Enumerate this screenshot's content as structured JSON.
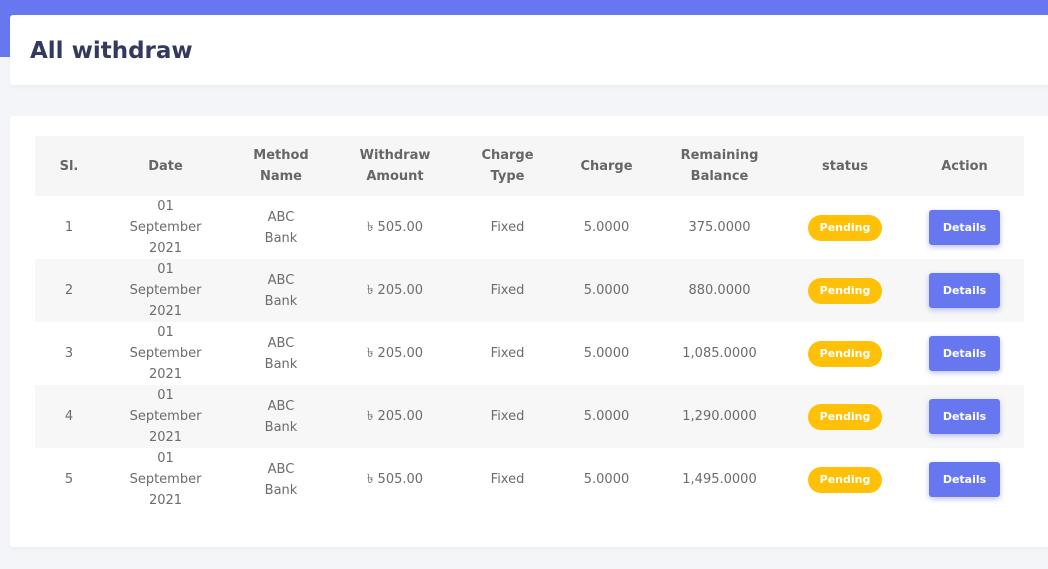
{
  "page": {
    "title": "All withdraw"
  },
  "colors": {
    "header_bar": "#6777ef",
    "badge_pending": "#ffc107",
    "button": "#6777ef"
  },
  "table": {
    "headers": {
      "sl": "Sl.",
      "date": "Date",
      "method_1": "Method",
      "method_2": "Name",
      "amount_1": "Withdraw",
      "amount_2": "Amount",
      "ctype_1": "Charge",
      "ctype_2": "Type",
      "charge": "Charge",
      "remain_1": "Remaining",
      "remain_2": "Balance",
      "status": "status",
      "action": "Action"
    },
    "rows": [
      {
        "sl": "1",
        "date_1": "01",
        "date_2": "September",
        "date_3": "2021",
        "method_1": "ABC",
        "method_2": "Bank",
        "amount": "৳ 505.00",
        "charge_type": "Fixed",
        "charge": "5.0000",
        "remaining": "375.0000",
        "status": "Pending",
        "action": "Details"
      },
      {
        "sl": "2",
        "date_1": "01",
        "date_2": "September",
        "date_3": "2021",
        "method_1": "ABC",
        "method_2": "Bank",
        "amount": "৳ 205.00",
        "charge_type": "Fixed",
        "charge": "5.0000",
        "remaining": "880.0000",
        "status": "Pending",
        "action": "Details"
      },
      {
        "sl": "3",
        "date_1": "01",
        "date_2": "September",
        "date_3": "2021",
        "method_1": "ABC",
        "method_2": "Bank",
        "amount": "৳ 205.00",
        "charge_type": "Fixed",
        "charge": "5.0000",
        "remaining": "1,085.0000",
        "status": "Pending",
        "action": "Details"
      },
      {
        "sl": "4",
        "date_1": "01",
        "date_2": "September",
        "date_3": "2021",
        "method_1": "ABC",
        "method_2": "Bank",
        "amount": "৳ 205.00",
        "charge_type": "Fixed",
        "charge": "5.0000",
        "remaining": "1,290.0000",
        "status": "Pending",
        "action": "Details"
      },
      {
        "sl": "5",
        "date_1": "01",
        "date_2": "September",
        "date_3": "2021",
        "method_1": "ABC",
        "method_2": "Bank",
        "amount": "৳ 505.00",
        "charge_type": "Fixed",
        "charge": "5.0000",
        "remaining": "1,495.0000",
        "status": "Pending",
        "action": "Details"
      }
    ]
  }
}
